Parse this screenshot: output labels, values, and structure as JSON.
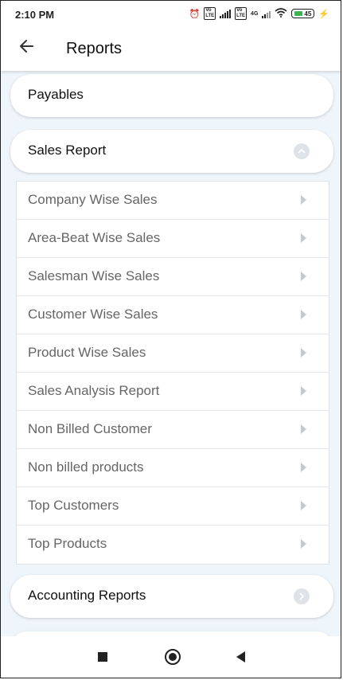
{
  "status_bar": {
    "time": "2:10 PM",
    "network": "4G",
    "battery": "45"
  },
  "header": {
    "title": "Reports"
  },
  "cards": {
    "payables": "Payables",
    "sales_report": "Sales Report",
    "accounting_reports": "Accounting Reports"
  },
  "sales_items": [
    "Company Wise Sales",
    "Area-Beat Wise Sales",
    "Salesman Wise Sales",
    "Customer Wise Sales",
    "Product Wise Sales",
    "Sales Analysis Report",
    "Non Billed Customer",
    "Non billed products",
    "Top Customers",
    "Top Products"
  ],
  "icons": {
    "back": "arrow-left-icon",
    "expand": "chevron-up-icon",
    "collapse": "chevron-right-icon",
    "item_arrow": "caret-right-icon"
  },
  "colors": {
    "background": "#eef5fb",
    "battery_fill": "#3fb34f"
  }
}
